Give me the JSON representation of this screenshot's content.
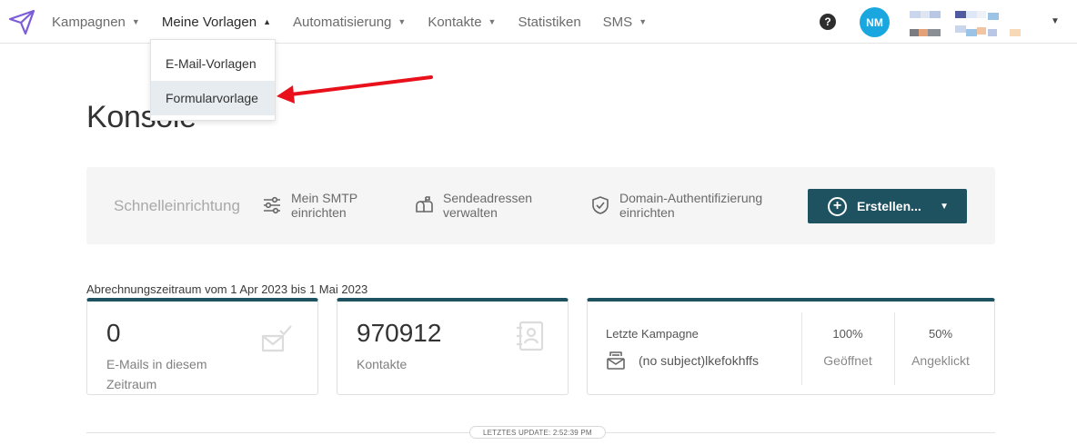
{
  "nav": {
    "items": [
      {
        "label": "Kampagnen",
        "has_caret": true
      },
      {
        "label": "Meine Vorlagen",
        "has_caret": true,
        "active": true
      },
      {
        "label": "Automatisierung",
        "has_caret": true
      },
      {
        "label": "Kontakte",
        "has_caret": true
      },
      {
        "label": "Statistiken",
        "has_caret": false
      },
      {
        "label": "SMS",
        "has_caret": true
      }
    ],
    "help_symbol": "?",
    "avatar_initials": "NM",
    "caret_down": "▼",
    "caret_up": "▲"
  },
  "dropdown": {
    "items": [
      {
        "label": "E-Mail-Vorlagen"
      },
      {
        "label": "Formularvorlage",
        "highlighted": true
      }
    ]
  },
  "page": {
    "title": "Konsole"
  },
  "quick_setup": {
    "label": "Schnelleinrichtung",
    "items": [
      {
        "line1": "Mein SMTP",
        "line2": "einrichten",
        "icon": "sliders-icon"
      },
      {
        "line1": "Sendeadressen",
        "line2": "verwalten",
        "icon": "mailbox-icon"
      },
      {
        "line1": "Domain-Authentifizierung",
        "line2": "einrichten",
        "icon": "shield-check-icon"
      }
    ],
    "create_label": "Erstellen...",
    "create_plus": "+"
  },
  "billing": {
    "period_text": "Abrechnungszeitraum vom 1 Apr 2023 bis 1 Mai 2023"
  },
  "cards": {
    "emails": {
      "value": "0",
      "label_line1": "E-Mails in diesem",
      "label_line2": "Zeitraum"
    },
    "contacts": {
      "value": "970912",
      "label": "Kontakte"
    },
    "last_campaign": {
      "label": "Letzte Kampagne",
      "subject": "(no subject)lkefokhffs",
      "opened_pct": "100%",
      "opened_label": "Geöffnet",
      "clicked_pct": "50%",
      "clicked_label": "Angeklickt"
    }
  },
  "footer": {
    "last_update": "LETZTES UPDATE: 2:52:39 PM"
  },
  "colors": {
    "accent_dark": "#1e5261",
    "avatar": "#1aa7e0",
    "annotation_arrow": "#e8101a",
    "logo": "#7b5cd6"
  }
}
